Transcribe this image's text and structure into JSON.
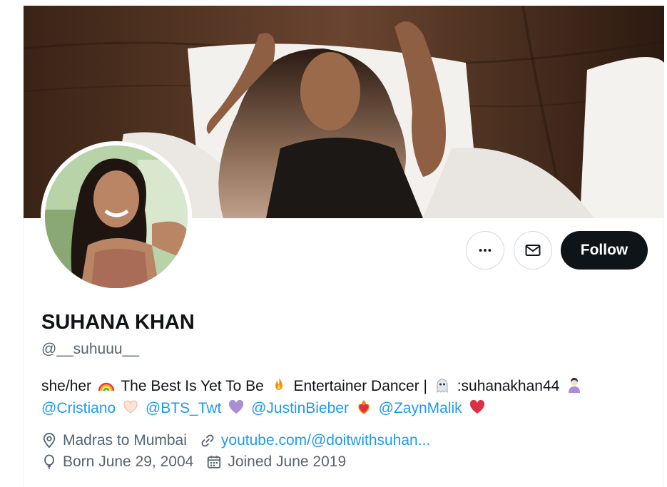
{
  "profile": {
    "display_name": "SUHANA KHAN",
    "handle": "@__suhuuu__",
    "bio": {
      "line1": {
        "t1": "she/her",
        "t2": "The Best Is Yet To Be",
        "t3": "Entertainer   Dancer |",
        "t4": ":suhanakhan44"
      },
      "line2": {
        "mention1": "@Cristiano",
        "mention2": "@BTS_Twt",
        "mention3": "@JustinBieber",
        "mention4": "@ZaynMalik"
      }
    },
    "location": "Madras to Mumbai",
    "website": "youtube.com/@doitwithsuhan...",
    "birthday": "Born June 29, 2004",
    "joined": "Joined June 2019"
  },
  "actions": {
    "follow_label": "Follow",
    "more_icon": "more-horizontal-icon",
    "message_icon": "envelope-icon"
  },
  "colors": {
    "accent": "#1d9bf0",
    "text_primary": "#0f1419",
    "text_secondary": "#536471",
    "follow_bg": "#0f1419"
  }
}
